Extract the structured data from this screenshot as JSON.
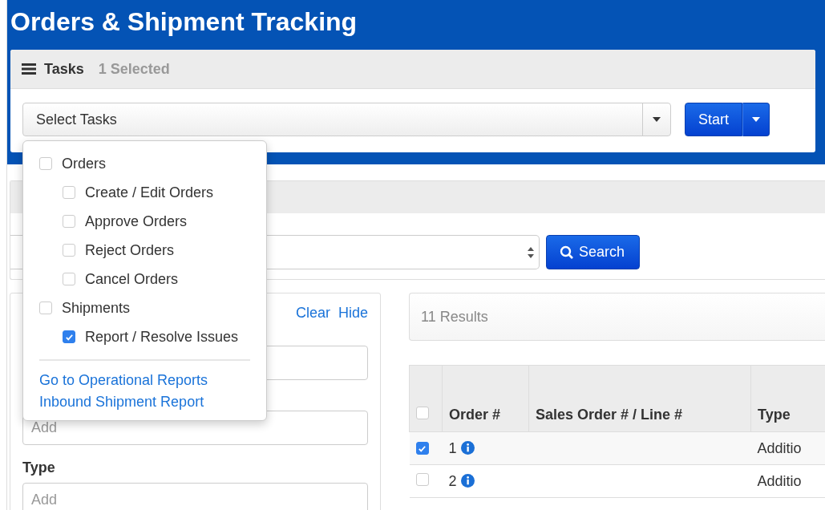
{
  "header": {
    "title": "Orders & Shipment Tracking"
  },
  "tasks": {
    "title": "Tasks",
    "selected_count": "1 Selected",
    "select_label": "Select Tasks",
    "start_button": "Start",
    "menu": {
      "groups": [
        {
          "label": "Orders",
          "checked": false,
          "children": [
            {
              "label": "Create / Edit Orders",
              "checked": false
            },
            {
              "label": "Approve Orders",
              "checked": false
            },
            {
              "label": "Reject Orders",
              "checked": false
            },
            {
              "label": "Cancel Orders",
              "checked": false
            }
          ]
        },
        {
          "label": "Shipments",
          "checked": false,
          "children": [
            {
              "label": "Report / Resolve Issues",
              "checked": true
            }
          ]
        }
      ],
      "links": [
        "Go to Operational Reports",
        "Inbound Shipment Report"
      ]
    }
  },
  "search": {
    "button": "Search"
  },
  "filters": {
    "actions": [
      "Clear",
      "Hide"
    ],
    "fields": [
      {
        "placeholder": "Add"
      },
      {
        "label": "Type",
        "placeholder": "Add"
      }
    ]
  },
  "results": {
    "count": "11 Results",
    "table": {
      "columns": [
        "Order #",
        "Sales Order # / Line #",
        "Type"
      ],
      "all_selected": false,
      "rows": [
        {
          "selected": true,
          "order": "1",
          "type": "Additio"
        },
        {
          "selected": false,
          "order": "2",
          "type": "Additio"
        }
      ]
    }
  }
}
